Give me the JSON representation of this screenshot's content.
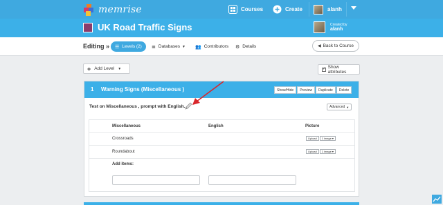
{
  "topbar": {
    "logo_text": "memrise",
    "nav": {
      "courses_label": "Courses",
      "create_label": "Create",
      "username": "alanh"
    }
  },
  "course": {
    "title": "UK Road Traffic Signs",
    "created_by_label": "Created by",
    "creator_name": "alanh"
  },
  "toolbar": {
    "editing_label": "Editing »",
    "tabs": [
      {
        "label": "Levels (2)",
        "icon": "list-icon",
        "active": true
      },
      {
        "label": "Databases",
        "icon": "database-icon",
        "active": false
      },
      {
        "label": "Contributors",
        "icon": "people-icon",
        "active": false
      },
      {
        "label": "Details",
        "icon": "gear-icon",
        "active": false
      }
    ],
    "back_label": "Back to Course"
  },
  "content": {
    "add_level_label": "Add Level",
    "show_attributes_label": "Show attributes",
    "level": {
      "number": "1",
      "title": "Warning Signs  (Miscellaneous )",
      "buttons": [
        "Show/Hide",
        "Preview",
        "Duplicate",
        "Delete"
      ],
      "test_text": "Test on Miscellaneous , prompt with English.",
      "advanced_label": "Advanced",
      "columns": [
        "Miscellaneous",
        "English",
        "Picture"
      ],
      "rows": [
        {
          "misc": "Crossroads",
          "english": "",
          "upload": "Upload",
          "images": "1 image"
        },
        {
          "misc": "Roundabout",
          "english": "",
          "upload": "Upload",
          "images": "1 image"
        }
      ],
      "add_items_label": "Add items:"
    }
  },
  "colors": {
    "brand_blue": "#3fa9e0",
    "annotation_red": "#d9262b"
  }
}
